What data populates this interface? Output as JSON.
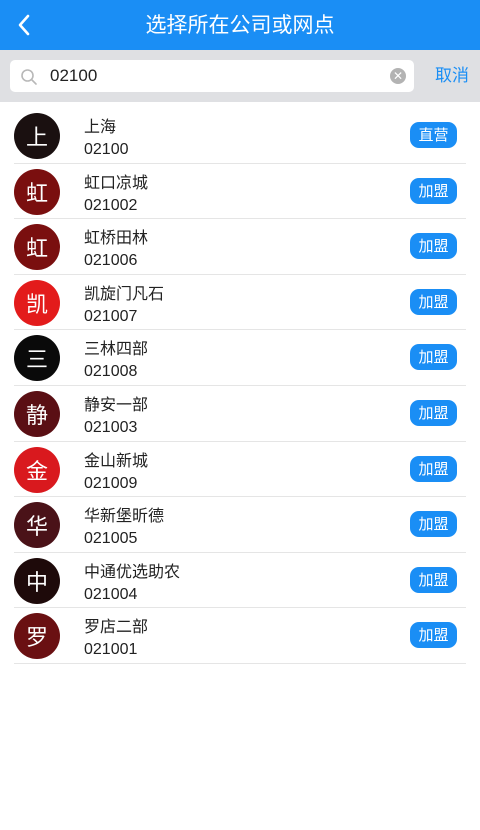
{
  "header": {
    "title": "选择所在公司或网点"
  },
  "search": {
    "value": "02100",
    "cancel_label": "取消"
  },
  "items": [
    {
      "avatar": "上",
      "name": "上海",
      "code": "02100",
      "tag": "直营",
      "color": "#1a1010"
    },
    {
      "avatar": "虹",
      "name": "虹口凉城",
      "code": "021002",
      "tag": "加盟",
      "color": "#7a0f0f"
    },
    {
      "avatar": "虹",
      "name": "虹桥田林",
      "code": "021006",
      "tag": "加盟",
      "color": "#7a0f0f"
    },
    {
      "avatar": "凯",
      "name": "凯旋门凡石",
      "code": "021007",
      "tag": "加盟",
      "color": "#e31b1b"
    },
    {
      "avatar": "三",
      "name": "三林四部",
      "code": "021008",
      "tag": "加盟",
      "color": "#0a0a0a"
    },
    {
      "avatar": "静",
      "name": "静安一部",
      "code": "021003",
      "tag": "加盟",
      "color": "#5a0f14"
    },
    {
      "avatar": "金",
      "name": "金山新城",
      "code": "021009",
      "tag": "加盟",
      "color": "#d9191e"
    },
    {
      "avatar": "华",
      "name": "华新堡昕德",
      "code": "021005",
      "tag": "加盟",
      "color": "#4a1218"
    },
    {
      "avatar": "中",
      "name": "中通优选助农",
      "code": "021004",
      "tag": "加盟",
      "color": "#1e0a0a"
    },
    {
      "avatar": "罗",
      "name": "罗店二部",
      "code": "021001",
      "tag": "加盟",
      "color": "#6a1012"
    }
  ]
}
